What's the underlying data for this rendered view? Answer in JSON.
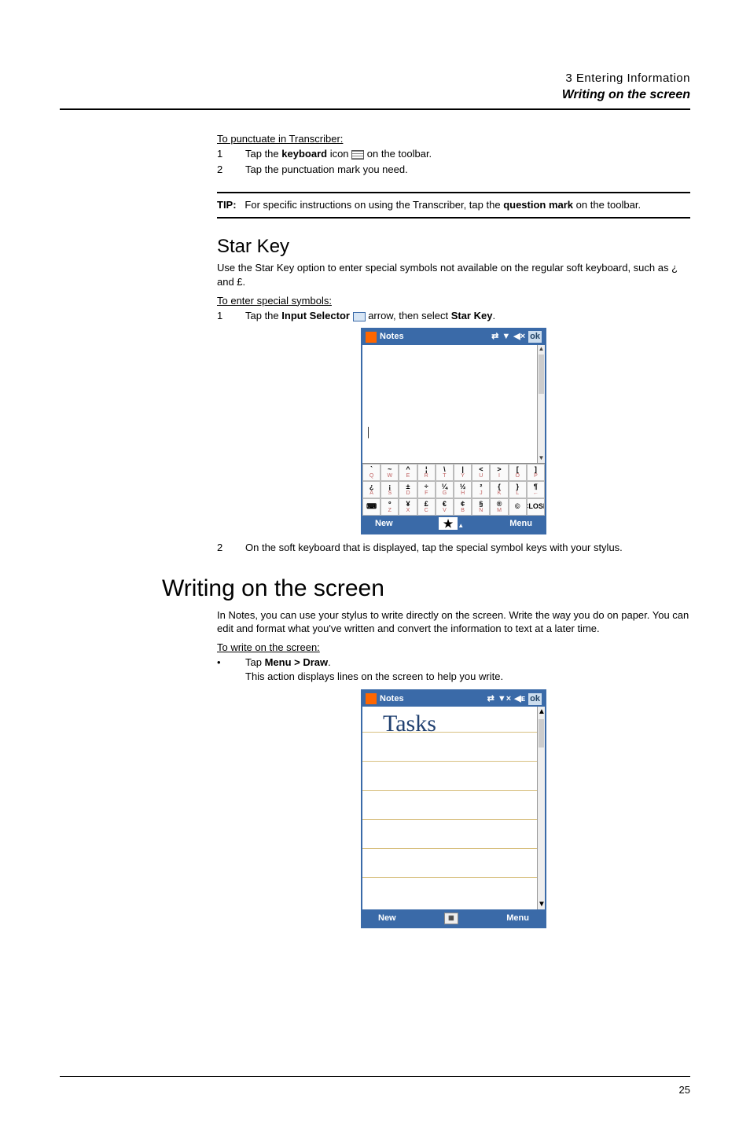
{
  "header": {
    "chapter": "3 Entering Information",
    "section": "Writing on the screen"
  },
  "punct": {
    "heading": "To punctuate in Transcriber:",
    "step1num": "1",
    "step1a": "Tap the ",
    "step1bold": "keyboard",
    "step1b": " icon ",
    "step1c": " on the toolbar.",
    "step2num": "2",
    "step2": "Tap the punctuation mark you need."
  },
  "tip": {
    "label": "TIP:",
    "body_a": "For specific instructions on using the Transcriber, tap the ",
    "body_bold": "question mark",
    "body_b": " on the toolbar."
  },
  "star": {
    "h": "Star Key",
    "intro": "Use the Star Key option to enter special symbols not available on the regular soft keyboard, such as ¿ and £.",
    "enter_h": "To enter special symbols:",
    "s1num": "1",
    "s1a": "Tap the ",
    "s1bold": "Input Selector",
    "s1b": " arrow, then select ",
    "s1bold2": "Star Key",
    "s1c": ".",
    "s2num": "2",
    "s2": "On the soft keyboard that is displayed, tap the special symbol keys with your stylus."
  },
  "writing": {
    "h": "Writing on the screen",
    "intro": "In Notes, you can use your stylus to write directly on the screen. Write the way you do on paper. You can edit and format what you've written and convert the information to text at a later time.",
    "sub": "To write on the screen:",
    "b1a": "Tap ",
    "b1bold": "Menu > Draw",
    "b1b": ".",
    "b1after": "This action displays lines on the screen to help you write."
  },
  "dev": {
    "title": "Notes",
    "ok": "ok",
    "new": "New",
    "menu": "Menu",
    "star": "★",
    "arrow": "▲",
    "hand": "Tasks",
    "row1": [
      "`",
      "~",
      "^",
      "¦",
      "\\",
      "|",
      "<",
      ">",
      "[",
      "]"
    ],
    "row1s": [
      "Q",
      "W",
      "E",
      "R",
      "T",
      "Y",
      "U",
      "I",
      "O",
      "P"
    ],
    "row2": [
      "¿",
      "¡",
      "±",
      "÷",
      "¼",
      "½",
      "²",
      "{",
      "}",
      "¶"
    ],
    "row2s": [
      "A",
      "S",
      "D",
      "F",
      "G",
      "H",
      "J",
      "K",
      "L",
      "←"
    ],
    "row3": [
      "⌨",
      "º",
      "¥",
      "£",
      "€",
      "¢",
      "§",
      "®",
      "©",
      "CLOSE"
    ],
    "row3s": [
      "",
      "Z",
      "X",
      "C",
      "V",
      "B",
      "N",
      "M",
      "",
      ""
    ]
  },
  "pagenum": "25"
}
